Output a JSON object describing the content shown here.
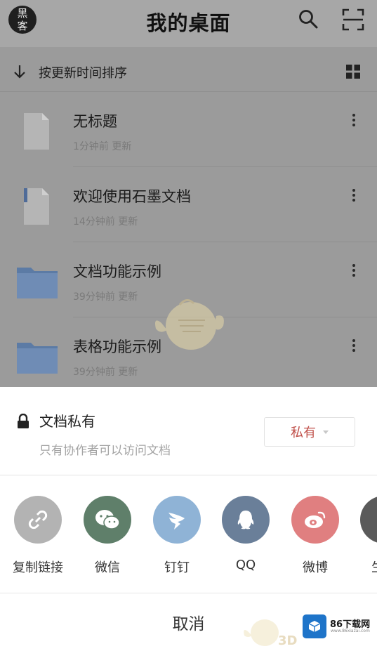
{
  "header": {
    "avatar_text": "黑客",
    "title": "我的桌面",
    "search_icon": "search-icon",
    "scan_icon": "scan-icon"
  },
  "sortbar": {
    "label": "按更新时间排序",
    "sort_icon": "arrow-down-icon",
    "view_icon": "grid-view-icon"
  },
  "files": [
    {
      "name": "无标题",
      "meta": "1分钟前 更新",
      "type": "document"
    },
    {
      "name": "欢迎使用石墨文档",
      "meta": "14分钟前 更新",
      "type": "document"
    },
    {
      "name": "文档功能示例",
      "meta": "39分钟前 更新",
      "type": "folder"
    },
    {
      "name": "表格功能示例",
      "meta": "39分钟前 更新",
      "type": "folder"
    }
  ],
  "sheet": {
    "privacy_title": "文档私有",
    "privacy_desc": "只有协作者可以访问文档",
    "privacy_value": "私有",
    "share_items": [
      {
        "label": "复制链接",
        "icon": "link-icon",
        "color": "#b3b3b3"
      },
      {
        "label": "微信",
        "icon": "wechat-icon",
        "color": "#5f7f6a"
      },
      {
        "label": "钉钉",
        "icon": "dingtalk-icon",
        "color": "#8fb3d6"
      },
      {
        "label": "QQ",
        "icon": "qq-icon",
        "color": "#6a7f99"
      },
      {
        "label": "微博",
        "icon": "weibo-icon",
        "color": "#e07f80"
      },
      {
        "label": "生成",
        "icon": "generate-icon",
        "color": "#5a5a5a"
      }
    ],
    "cancel_label": "取消"
  },
  "watermark": {
    "site_name": "86下载网",
    "site_sub": "www.86xiazai.com",
    "side_text": "3D"
  }
}
